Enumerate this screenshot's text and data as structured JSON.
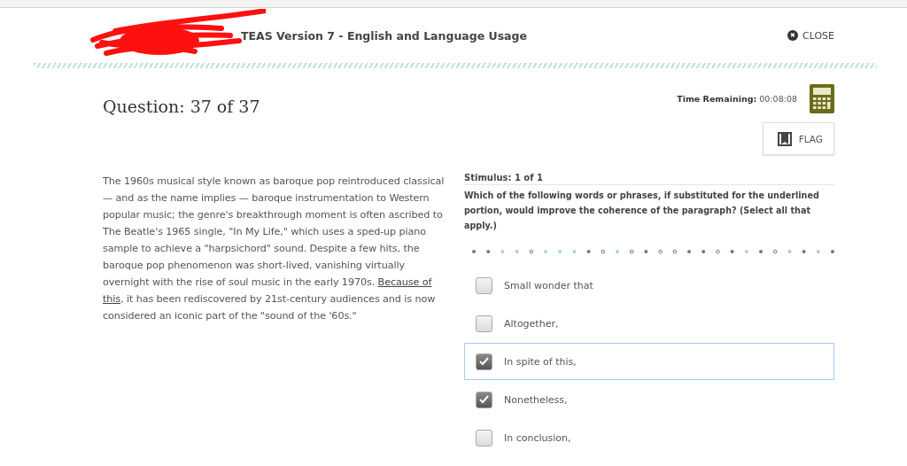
{
  "header": {
    "title": "TEAS Version 7 - English and Language Usage",
    "close_icon": "✖",
    "close_label": "CLOSE"
  },
  "question": {
    "title": "Question: 37 of 37",
    "time_label": "Time Remaining:",
    "time_value": "00:08:08",
    "flag_label": "FLAG"
  },
  "passage": {
    "before": "The 1960s musical style known as baroque pop reintroduced classical — and as the name implies — baroque instrumentation to Western popular music; the genre's breakthrough moment is often ascribed to The Beatle's 1965 single, \"In My Life,\" which uses a sped-up piano sample to achieve a \"harpsichord\" sound. Despite a few hits, the baroque pop phenomenon was short-lived, vanishing virtually overnight with the rise of soul music in the early 1970s. ",
    "underlined": "Because of this",
    "after": ", it has been rediscovered by 21st-century audiences and is now considered an iconic part of the \"sound of the '60s.\""
  },
  "stimulus": {
    "label": "Stimulus: 1 of 1",
    "prompt": "Which of the following words or phrases, if substituted for the underlined portion, would improve the coherence of the paragraph? (Select all that apply.)"
  },
  "options": [
    {
      "label": "Small wonder that",
      "checked": false,
      "focused": false
    },
    {
      "label": "Altogether,",
      "checked": false,
      "focused": false
    },
    {
      "label": "In spite of this,",
      "checked": true,
      "focused": true
    },
    {
      "label": "Nonetheless,",
      "checked": true,
      "focused": false
    },
    {
      "label": "In conclusion,",
      "checked": false,
      "focused": false
    }
  ]
}
